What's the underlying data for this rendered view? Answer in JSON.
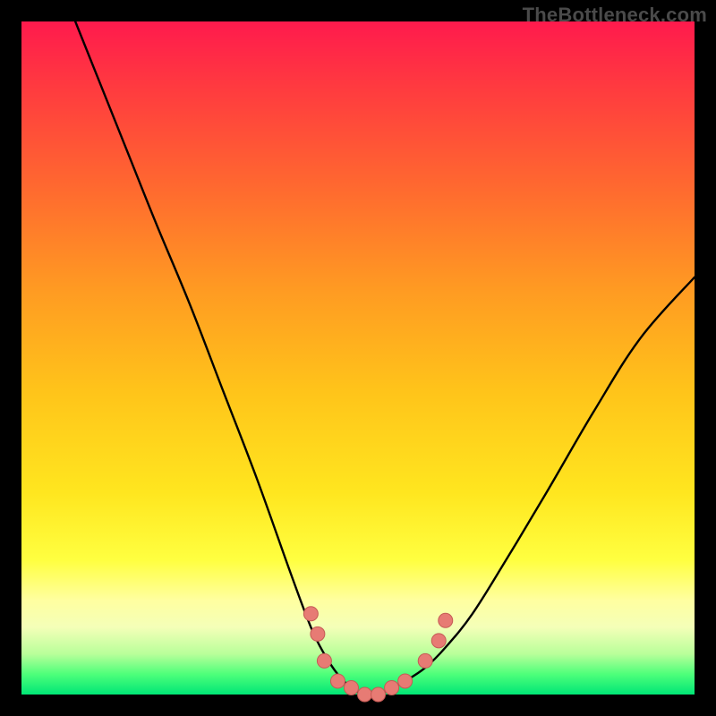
{
  "watermark": {
    "text": "TheBottleneck.com"
  },
  "colors": {
    "frame": "#000000",
    "curve_stroke": "#000000",
    "marker_fill": "#e77b74",
    "marker_stroke": "#c55a55",
    "gradient_stops": [
      "#ff1a4d",
      "#ff6a2f",
      "#ffc41a",
      "#ffff40",
      "#00e676"
    ]
  },
  "chart_data": {
    "type": "line",
    "title": "",
    "xlabel": "",
    "ylabel": "",
    "xlim": [
      0,
      100
    ],
    "ylim": [
      0,
      100
    ],
    "series": [
      {
        "name": "bottleneck-curve",
        "x": [
          8,
          12,
          16,
          20,
          25,
          30,
          35,
          40,
          43,
          45,
          47,
          49,
          51,
          53,
          55,
          57,
          60,
          63,
          67,
          72,
          78,
          85,
          92,
          100
        ],
        "y": [
          100,
          90,
          80,
          70,
          58,
          45,
          32,
          18,
          10,
          6,
          3,
          1,
          0,
          0,
          1,
          2,
          4,
          7,
          12,
          20,
          30,
          42,
          53,
          62
        ]
      }
    ],
    "markers": [
      {
        "x": 43,
        "y": 12
      },
      {
        "x": 44,
        "y": 9
      },
      {
        "x": 45,
        "y": 5
      },
      {
        "x": 47,
        "y": 2
      },
      {
        "x": 49,
        "y": 1
      },
      {
        "x": 51,
        "y": 0
      },
      {
        "x": 53,
        "y": 0
      },
      {
        "x": 55,
        "y": 1
      },
      {
        "x": 57,
        "y": 2
      },
      {
        "x": 60,
        "y": 5
      },
      {
        "x": 62,
        "y": 8
      },
      {
        "x": 63,
        "y": 11
      }
    ]
  }
}
